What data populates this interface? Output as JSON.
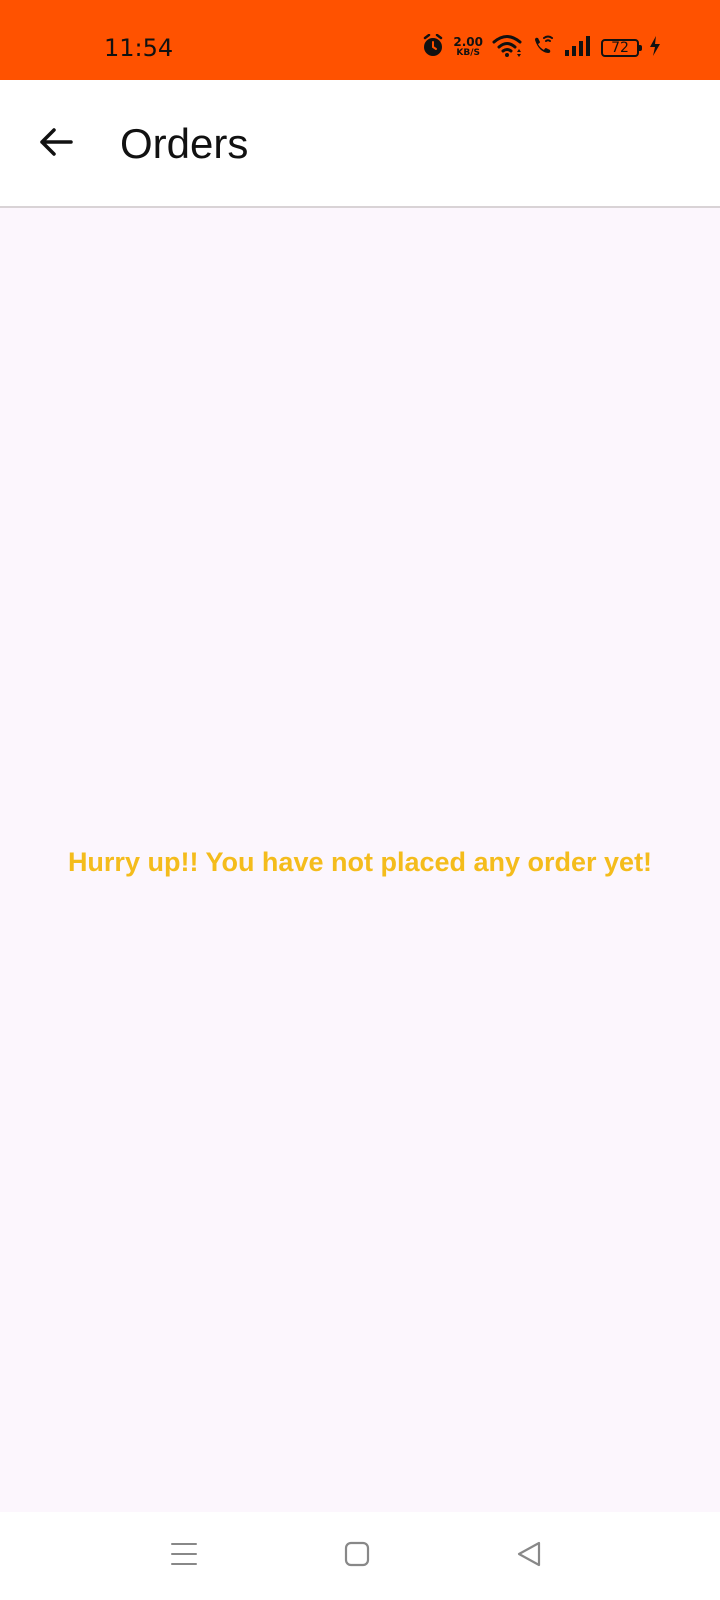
{
  "status_bar": {
    "time": "11:54",
    "net_speed_value": "2.00",
    "net_speed_unit": "KB/S",
    "battery_level": "72",
    "icons": [
      "alarm-icon",
      "wifi-icon",
      "wifi-calling-icon",
      "signal-icon",
      "battery-icon",
      "charging-icon"
    ],
    "background_color": "#ff5200"
  },
  "app_bar": {
    "title": "Orders",
    "back_icon": "arrow-left-icon"
  },
  "content": {
    "empty_message": "Hurry up!! You have not placed any order yet!",
    "message_color": "#f4bc1c",
    "background_color": "#fcf6fd"
  },
  "nav_bar": {
    "icons": [
      "recent-apps-icon",
      "home-icon",
      "back-triangle-icon"
    ]
  }
}
